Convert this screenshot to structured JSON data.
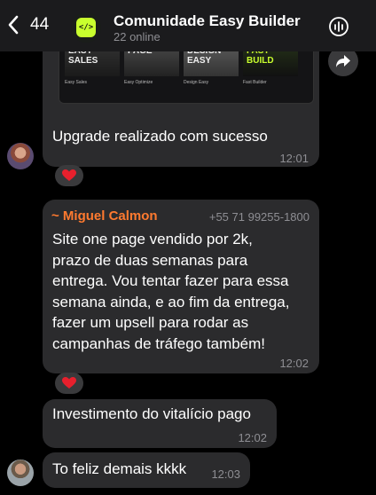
{
  "header": {
    "back_count": "44",
    "title": "Comunidade Easy Builder",
    "subtitle": "22 online"
  },
  "image_message": {
    "thumbnails": [
      {
        "text": "EASY SALES",
        "label": "Easy Sales"
      },
      {
        "text": "PAGE",
        "label": "Easy Optimize"
      },
      {
        "text": "DESIGN EASY",
        "label": "Design Easy"
      },
      {
        "text": "FAST BUILD",
        "label": "Fast Builder"
      }
    ]
  },
  "messages": [
    {
      "text_lines": [
        "Upgrade realizado com sucesso"
      ],
      "time": "12:01",
      "reaction": "❤️"
    },
    {
      "sender": "~ Miguel Calmon",
      "phone": "+55 71 99255-1800",
      "text_lines": [
        "Site one page vendido por 2k,",
        "prazo de duas semanas para",
        "entrega. Vou tentar fazer para essa",
        "semana ainda, e ao fim da entrega,",
        "fazer um upsell para rodar as",
        "campanhas de tráfego também!"
      ],
      "time": "12:02",
      "reaction": "❤️"
    },
    {
      "text_lines": [
        "Investimento do vitalício pago"
      ],
      "time": "12:02"
    },
    {
      "text_lines": [
        "To feliz demais kkkk"
      ],
      "time": "12:03"
    }
  ],
  "colors": {
    "sender_name": "#ff7a2f",
    "bubble": "#2b2b2d",
    "accent_logo": "#c9ff2e"
  }
}
